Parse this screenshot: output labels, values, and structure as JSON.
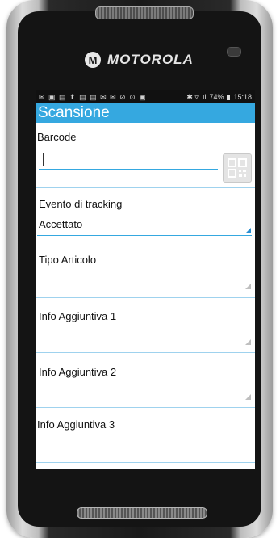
{
  "device": {
    "brand": "MOTOROLA",
    "logo_glyph": "M"
  },
  "status_bar": {
    "icons": "✉ ▣ ▤ ⬆ ▤ ▤ ✉ ✉ ⊘ ⊙ ▣",
    "extra": "✱ ▿ .ıl",
    "battery": "74%",
    "time": "15:18"
  },
  "app": {
    "title": "Scansione"
  },
  "form": {
    "barcode": {
      "label": "Barcode",
      "value": ""
    },
    "tracking_event": {
      "label": "Evento di tracking",
      "selected": "Accettato"
    },
    "article_type": {
      "label": "Tipo Articolo",
      "value": ""
    },
    "info1": {
      "label": "Info Aggiuntiva 1",
      "value": ""
    },
    "info2": {
      "label": "Info Aggiuntiva 2",
      "value": ""
    },
    "info3": {
      "label": "Info Aggiuntiva 3",
      "value": ""
    }
  },
  "colors": {
    "accent": "#35a8e0",
    "underline": "#6fc1e8"
  }
}
